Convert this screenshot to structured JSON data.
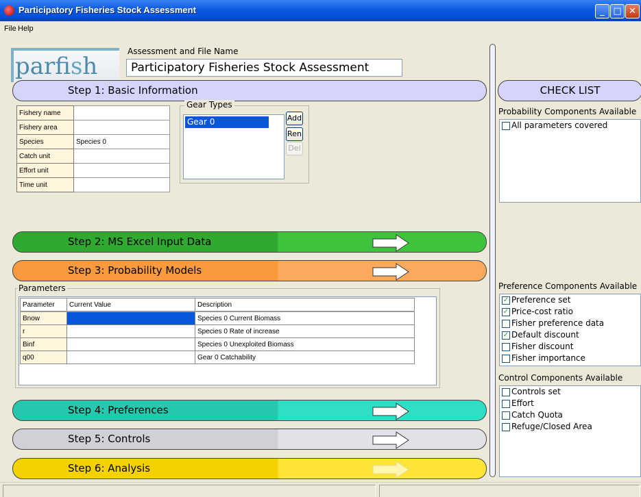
{
  "window": {
    "title": "Participatory Fisheries Stock Assessment",
    "minimize": "_",
    "maximize": "□",
    "close": "✕"
  },
  "menu": [
    "File",
    "Help"
  ],
  "logo": {
    "text_a": "parfi",
    "text_b": "s",
    "text_c": "h"
  },
  "assessment": {
    "label": "Assessment and File Name",
    "value": "Participatory Fisheries Stock Assessment"
  },
  "steps": [
    {
      "label": "Step 1: Basic Information",
      "color": "#d4d4fc"
    },
    {
      "label": "Step 2: MS Excel Input Data",
      "color": "#2fa92f"
    },
    {
      "label": "Step 3: Probability Models",
      "color": "#f99a3e"
    },
    {
      "label": "Step 4: Preferences",
      "color": "#26c8ad"
    },
    {
      "label": "Step 5: Controls",
      "color": "#d0d0d7"
    },
    {
      "label": "Step 6: Analysis",
      "color": "#f4d200"
    }
  ],
  "basic_info": [
    {
      "label": "Fishery name",
      "value": ""
    },
    {
      "label": "Fishery area",
      "value": ""
    },
    {
      "label": "Species",
      "value": "Species 0"
    },
    {
      "label": "Catch unit",
      "value": ""
    },
    {
      "label": "Effort unit",
      "value": ""
    },
    {
      "label": "Time unit",
      "value": ""
    }
  ],
  "gear": {
    "title": "Gear Types",
    "items": [
      "Gear  0"
    ],
    "add": "Add",
    "ren": "Ren",
    "del": "Del"
  },
  "parameters": {
    "title": "Parameters",
    "columns": [
      "Parameter",
      "Current Value",
      "Description"
    ],
    "rows": [
      {
        "param": "Bnow",
        "value": "",
        "desc": "Species 0 Current Biomass"
      },
      {
        "param": "r",
        "value": "",
        "desc": "Species 0 Rate of increase"
      },
      {
        "param": "Binf",
        "value": "",
        "desc": "Species 0 Unexploited Biomass"
      },
      {
        "param": "q00",
        "value": "",
        "desc": "Gear  0 Catchability"
      }
    ]
  },
  "checklist": {
    "title": "CHECK LIST",
    "probability": {
      "label": "Probability Components Available",
      "items": [
        {
          "text": "All parameters covered",
          "checked": false
        }
      ]
    },
    "preference": {
      "label": "Preference Components Available",
      "items": [
        {
          "text": "Preference set",
          "checked": true
        },
        {
          "text": "Price-cost ratio",
          "checked": true
        },
        {
          "text": "Fisher preference data",
          "checked": false
        },
        {
          "text": "Default discount",
          "checked": true
        },
        {
          "text": "Fisher discount",
          "checked": false
        },
        {
          "text": "Fisher importance",
          "checked": false
        }
      ]
    },
    "control": {
      "label": "Control Components Available",
      "items": [
        {
          "text": "Controls set",
          "checked": false
        },
        {
          "text": "Effort",
          "checked": false
        },
        {
          "text": "Catch Quota",
          "checked": false
        },
        {
          "text": "Refuge/Closed Area",
          "checked": false
        }
      ]
    }
  }
}
